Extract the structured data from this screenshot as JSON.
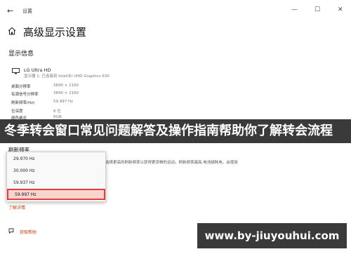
{
  "window": {
    "title": "设置",
    "back_icon": "back-arrow-icon",
    "min_glyph": "—",
    "max_glyph": "☐",
    "close_glyph": "✕"
  },
  "page": {
    "title": "高级显示设置",
    "icon": "home-icon"
  },
  "display_info": {
    "heading": "显示信息",
    "monitor_name": "LG Ultra HD",
    "monitor_sub": "显示器 1: 已连接到 Intel(R) UHD Graphics 630",
    "rows": [
      {
        "label": "桌面分辨率",
        "value": "3840 × 2160"
      },
      {
        "label": "有源信号分辨率",
        "value": "3840 × 2160"
      },
      {
        "label": "刷新频率(Hz)",
        "value": "59.997 Hz"
      },
      {
        "label": "位深度",
        "value": "8 位"
      },
      {
        "label": "颜色格式",
        "value": "RGB"
      }
    ]
  },
  "banner": {
    "text": "冬季转会窗口常见问题解答及操作指南帮助你了解转会流程"
  },
  "refresh": {
    "heading": "刷新频率",
    "description": "选择更高的刷新频率以获得更流畅的运动。刷新频率越高,电池越耗电。会使用",
    "options": [
      "29.970 Hz",
      "30.000 Hz",
      "59.937 Hz",
      "59.997 Hz"
    ],
    "selected_index": 3
  },
  "links": {
    "details": "了解详情",
    "help": "获取帮助"
  },
  "watermark": {
    "text": "www.by-jiuyouhui.com"
  },
  "colors": {
    "accent_link": "#c2410c",
    "selected_border": "#e53d3d",
    "selected_fill": "#f8d4cf",
    "banner_bg": "#3a3a3a"
  }
}
